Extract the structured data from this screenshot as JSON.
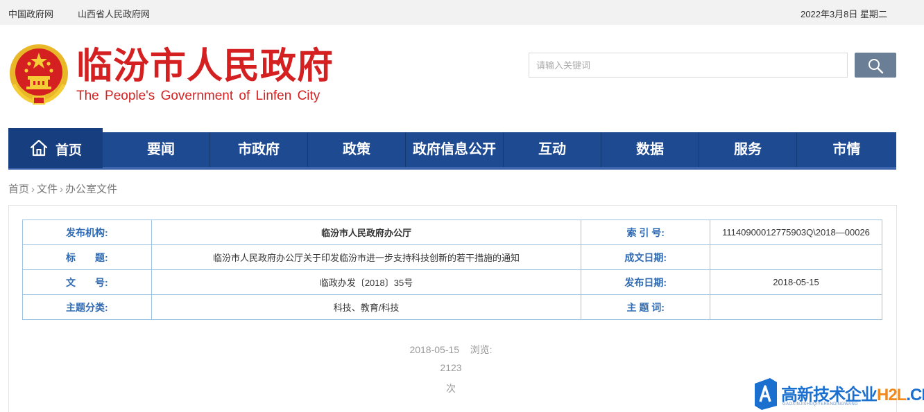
{
  "topbar": {
    "links": [
      "中国政府网",
      "山西省人民政府网"
    ],
    "date": "2022年3月8日 星期二"
  },
  "header": {
    "title": "临汾市人民政府",
    "subtitle": "The People's Government of Linfen City",
    "search_placeholder": "请输入关键词",
    "brand_color": "#d42020"
  },
  "nav": {
    "home": "首页",
    "items": [
      "要闻",
      "市政府",
      "政策",
      "政府信息公开",
      "互动",
      "数据",
      "服务",
      "市情"
    ],
    "bg_color": "#1e4a92"
  },
  "breadcrumb": [
    "首页",
    "文件",
    "办公室文件"
  ],
  "meta_table": {
    "rows": [
      {
        "label1": "发布机构:",
        "value1": "临汾市人民政府办公厅",
        "label2": "索 引 号:",
        "value2": "11140900012775903Q\\2018—00026"
      },
      {
        "label1": "标　　题:",
        "value1": "临汾市人民政府办公厅关于印发临汾市进一步支持科技创新的若干措施的通知",
        "label2": "成文日期:",
        "value2": ""
      },
      {
        "label1": "文　　号:",
        "value1": "临政办发〔2018〕35号",
        "label2": "发布日期:",
        "value2": "2018-05-15"
      },
      {
        "label1": "主题分类:",
        "value1": "科技、教育/科技",
        "label2": "主 题 词:",
        "value2": ""
      }
    ]
  },
  "pubinfo": {
    "date": "2018-05-15",
    "views_label": "浏览:",
    "views": "2123",
    "views_unit": "次"
  },
  "watermark": {
    "main": "高新技术企业",
    "site_a": "H2L",
    "site_b": ".CN",
    "sub": "GAOXINJISHUQIYERENDINGWANG"
  }
}
